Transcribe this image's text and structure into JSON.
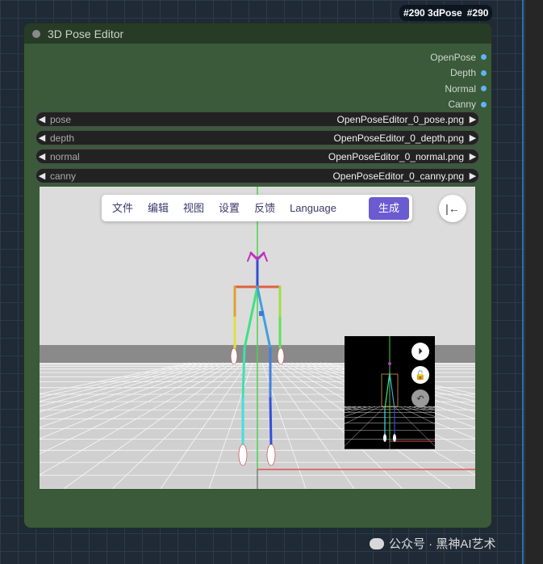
{
  "badge": {
    "title": "#290 3dPose",
    "id": "#290"
  },
  "node": {
    "title": "3D Pose Editor"
  },
  "outputs": [
    "OpenPose",
    "Depth",
    "Normal",
    "Canny"
  ],
  "widgets": [
    {
      "label": "pose",
      "value": "OpenPoseEditor_0_pose.png"
    },
    {
      "label": "depth",
      "value": "OpenPoseEditor_0_depth.png"
    },
    {
      "label": "normal",
      "value": "OpenPoseEditor_0_normal.png"
    },
    {
      "label": "canny",
      "value": "OpenPoseEditor_0_canny.png"
    }
  ],
  "editor": {
    "menu": [
      "文件",
      "编辑",
      "视图",
      "设置",
      "反馈",
      "Language"
    ],
    "generate": "生成",
    "collapse_icon": "collapse-left-icon",
    "preview_buttons": [
      "play-icon",
      "unlock-icon",
      "undo-icon"
    ]
  },
  "watermark": {
    "text": "公众号 · 黑神AI艺术"
  },
  "colors": {
    "accent": "#6b5bd1",
    "node_bg": "#3a5a39",
    "socket": "#5fb4f0"
  }
}
